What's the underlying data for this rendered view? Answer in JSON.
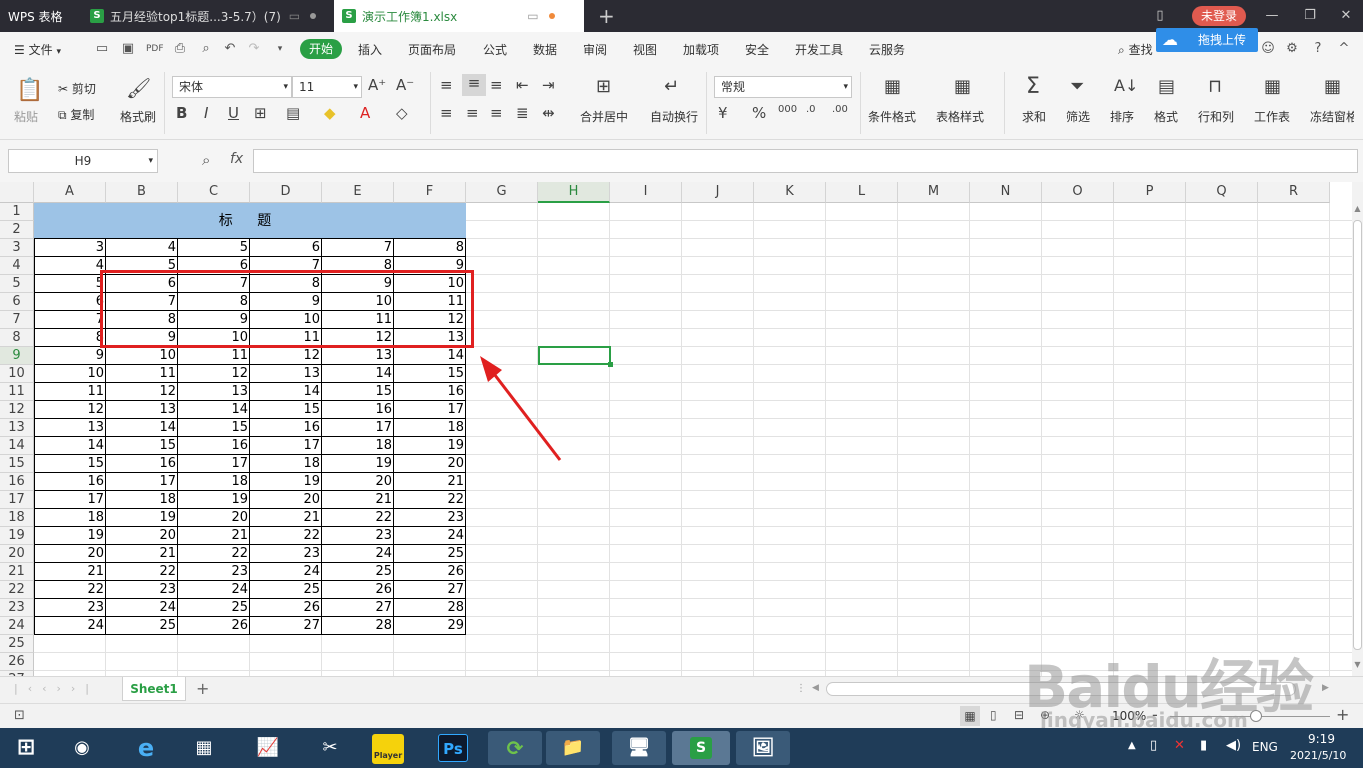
{
  "app": {
    "app_tab": "WPS 表格",
    "tabs": [
      {
        "label": "五月经验top1标题...3-5.7）(7)",
        "active": false
      },
      {
        "label": "演示工作簿1.xlsx",
        "active": true
      }
    ],
    "new_tab": "+",
    "login": "未登录"
  },
  "menu": {
    "file": "文件",
    "items": [
      "开始",
      "插入",
      "页面布局",
      "公式",
      "数据",
      "审阅",
      "视图",
      "加载项",
      "安全",
      "开发工具",
      "云服务"
    ],
    "find": "查找",
    "upload": "拖拽上传"
  },
  "ribbon": {
    "paste": "粘贴",
    "cut": "剪切",
    "copy": "复制",
    "format_painter": "格式刷",
    "font_name": "宋体",
    "font_size": "11",
    "number_format": "常规",
    "merge_center": "合并居中",
    "wrap_text": "自动换行",
    "cond_format": "条件格式",
    "table_style": "表格样式",
    "sum": "求和",
    "filter": "筛选",
    "sort": "排序",
    "format": "格式",
    "row_col": "行和列",
    "worksheet": "工作表",
    "freeze": "冻结窗格"
  },
  "formula_bar": {
    "name_box": "H9",
    "fx": "fx",
    "value": ""
  },
  "columns": [
    "A",
    "B",
    "C",
    "D",
    "E",
    "F",
    "G",
    "H",
    "I",
    "J",
    "K",
    "L",
    "M",
    "N",
    "O",
    "P",
    "Q",
    "R"
  ],
  "selected_column": "H",
  "selected_row": 9,
  "rows": [
    "1",
    "2",
    "3",
    "4",
    "5",
    "6",
    "7",
    "8",
    "9",
    "10",
    "11",
    "12",
    "13",
    "14",
    "15",
    "16",
    "17",
    "18",
    "19",
    "20",
    "21",
    "22",
    "23",
    "24",
    "25",
    "26",
    "27"
  ],
  "table_title": "标 题",
  "table_values": [
    [
      3,
      4,
      5,
      6,
      7,
      8
    ],
    [
      4,
      5,
      6,
      7,
      8,
      9
    ],
    [
      5,
      6,
      7,
      8,
      9,
      10
    ],
    [
      6,
      7,
      8,
      9,
      10,
      11
    ],
    [
      7,
      8,
      9,
      10,
      11,
      12
    ],
    [
      8,
      9,
      10,
      11,
      12,
      13
    ],
    [
      9,
      10,
      11,
      12,
      13,
      14
    ],
    [
      10,
      11,
      12,
      13,
      14,
      15
    ],
    [
      11,
      12,
      13,
      14,
      15,
      16
    ],
    [
      12,
      13,
      14,
      15,
      16,
      17
    ],
    [
      13,
      14,
      15,
      16,
      17,
      18
    ],
    [
      14,
      15,
      16,
      17,
      18,
      19
    ],
    [
      15,
      16,
      17,
      18,
      19,
      20
    ],
    [
      16,
      17,
      18,
      19,
      20,
      21
    ],
    [
      17,
      18,
      19,
      20,
      21,
      22
    ],
    [
      18,
      19,
      20,
      21,
      22,
      23
    ],
    [
      19,
      20,
      21,
      22,
      23,
      24
    ],
    [
      20,
      21,
      22,
      23,
      24,
      25
    ],
    [
      21,
      22,
      23,
      24,
      25,
      26
    ],
    [
      22,
      23,
      24,
      25,
      26,
      27
    ],
    [
      23,
      24,
      25,
      26,
      27,
      28
    ],
    [
      24,
      25,
      26,
      27,
      28,
      29
    ]
  ],
  "sheet": {
    "tab": "Sheet1",
    "add": "+"
  },
  "status": {
    "zoom": "100%",
    "minus": "-",
    "plus": "+"
  },
  "taskbar": {
    "player_label": "Player",
    "ps_label": "Ps",
    "lang": "ENG",
    "time": "9:19",
    "date": "2021/5/10"
  },
  "watermark": {
    "brand": "Baidu经验",
    "url": "jingyan.baidu.com"
  },
  "colors": {
    "accent_green": "#2a9f45",
    "title_fill": "#9dc3e6",
    "annotation_red": "#e02020"
  }
}
